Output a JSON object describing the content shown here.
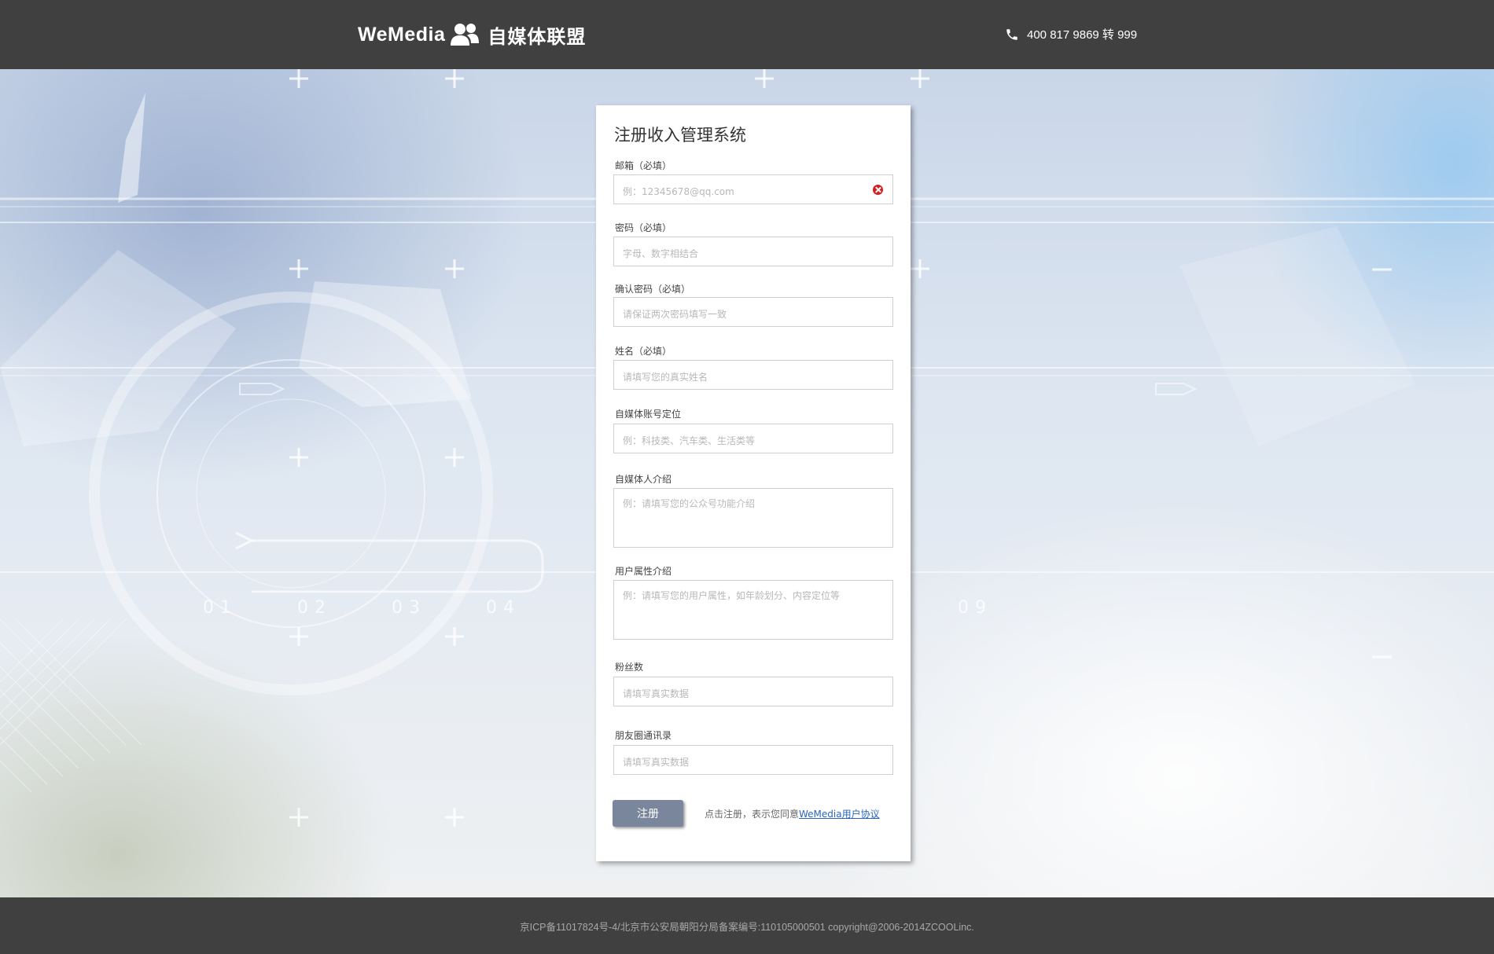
{
  "header": {
    "logo_en": "WeMedia",
    "logo_cn": "自媒体联盟",
    "phone_icon": "phone-icon",
    "phone": "400 817 9869 转 999"
  },
  "form": {
    "title": "注册收入管理系统",
    "fields": [
      {
        "label": "邮箱（必填）",
        "placeholder": "例：12345678@qq.com",
        "value": "",
        "error": true
      },
      {
        "label": "密码（必填）",
        "placeholder": "字母、数字相结合",
        "value": ""
      },
      {
        "label": "确认密码（必填）",
        "placeholder": "请保证两次密码填写一致",
        "value": ""
      },
      {
        "label": "姓名（必填）",
        "placeholder": "请填写您的真实姓名",
        "value": ""
      },
      {
        "label": "自媒体账号定位",
        "placeholder": "例：科技类、汽车类、生活类等",
        "value": ""
      },
      {
        "label": "自媒体人介绍",
        "placeholder": "例：请填写您的公众号功能介绍",
        "value": ""
      },
      {
        "label": "用户属性介绍",
        "placeholder": "例：请填写您的用户属性，如年龄划分、内容定位等",
        "value": ""
      },
      {
        "label": "粉丝数",
        "placeholder": "请填写真实数据",
        "value": ""
      },
      {
        "label": "朋友圈通讯录",
        "placeholder": "请填写真实数据",
        "value": ""
      }
    ],
    "submit_label": "注册",
    "agree_text": "点击注册，表示您同意",
    "agree_link": "WeMedia用户协议"
  },
  "footer": {
    "text": "京ICP备11017824号-4/北京市公安局朝阳分局备案编号:110105000501  copyright@2006-2014ZCOOLinc."
  },
  "colors": {
    "header_bg": "#404040",
    "button_bg": "#7a869c",
    "link": "#2a66b8",
    "error": "#d21f1f"
  }
}
